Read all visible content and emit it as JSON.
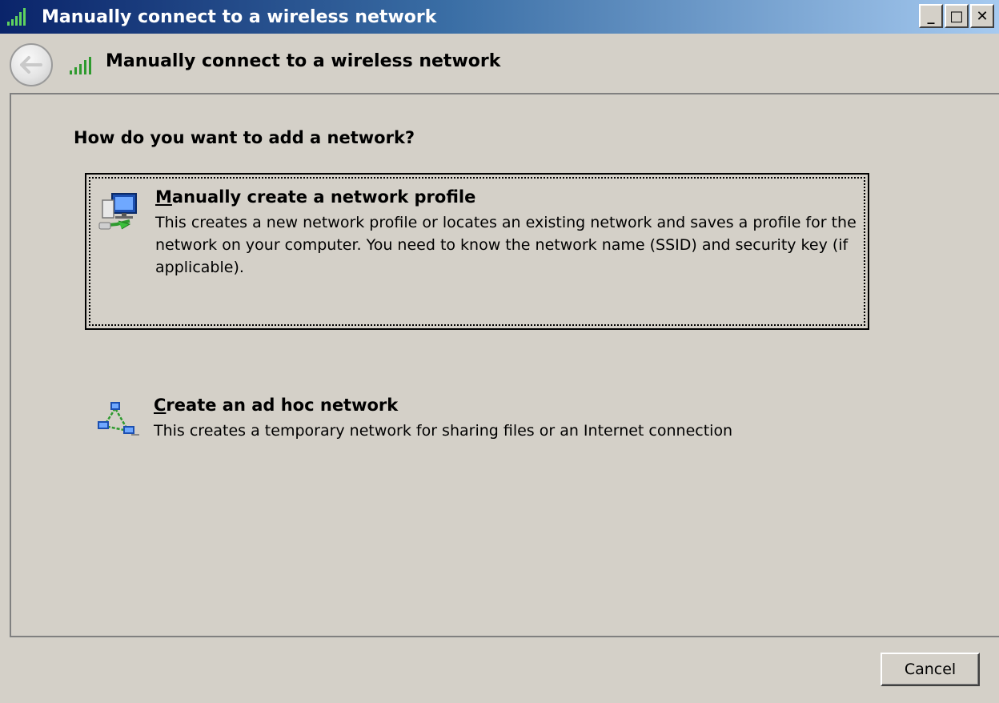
{
  "window": {
    "title": "Manually connect to a wireless network",
    "buttons": {
      "minimize": "_",
      "maximize": "□",
      "close": "✕"
    }
  },
  "nav": {
    "title": "Manually connect to a wireless network",
    "back_icon": "back-arrow-icon"
  },
  "main": {
    "question": "How do you want to add a network?",
    "options": [
      {
        "accel": "M",
        "title_rest": "anually create a network profile",
        "description": "This creates a new network profile or locates an existing network and saves a profile for the network on your computer. You need to know the network name (SSID) and security key (if applicable).",
        "icon": "network-computer-icon",
        "selected": true
      },
      {
        "accel": "C",
        "title_rest": "reate an ad hoc network",
        "description": "This creates a temporary network for sharing files or an Internet connection",
        "icon": "adhoc-network-icon",
        "selected": false
      }
    ]
  },
  "footer": {
    "cancel_label": "Cancel"
  },
  "colors": {
    "window_bg": "#d4d0c8",
    "title_start": "#0a246a",
    "title_end": "#a6caf0",
    "signal_green": "#2e9a2e"
  }
}
